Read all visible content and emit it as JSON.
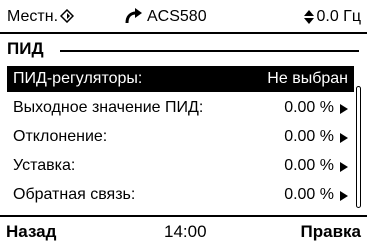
{
  "status": {
    "location": "Местн.",
    "drive_name": "ACS580",
    "reference": "0.0 Гц",
    "icons": {
      "location": "location-diamond-icon",
      "rotation": "rotation-clockwise-icon",
      "reference": "up-down-arrows-icon"
    }
  },
  "page": {
    "title": "ПИД"
  },
  "list": {
    "items": [
      {
        "label": "ПИД-регуляторы:",
        "value": "Не выбран"
      },
      {
        "label": "Выходное значение ПИД:",
        "value": "0.00 %"
      },
      {
        "label": "Отклонение:",
        "value": "0.00 %"
      },
      {
        "label": "Уставка:",
        "value": "0.00 %"
      },
      {
        "label": "Обратная связь:",
        "value": "0.00 %"
      }
    ],
    "partial_item_value": "%",
    "selected_index": 0
  },
  "bottom": {
    "back_label": "Назад",
    "time": "14:00",
    "edit_label": "Правка"
  },
  "colors": {
    "background": "#ffffff",
    "foreground": "#000000",
    "selection": "#000000"
  }
}
